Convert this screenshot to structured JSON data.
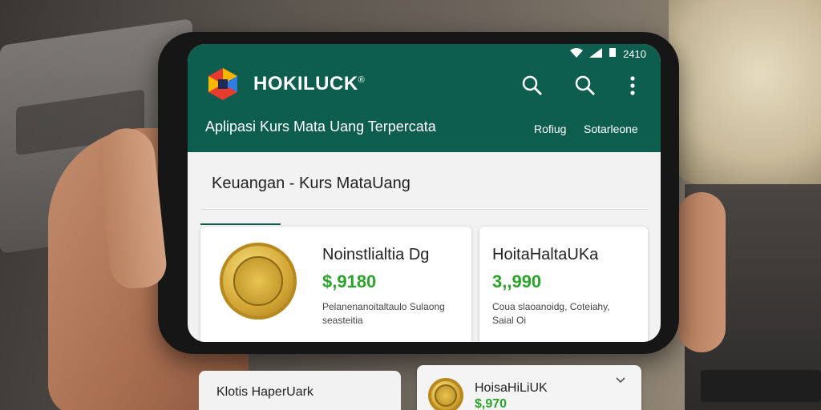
{
  "status_bar": {
    "time": "2410"
  },
  "header": {
    "brand": "HOKILUCK",
    "brand_mark": "®",
    "subtitle": "Aplipasi Kurs Mata Uang Terpercata",
    "links": [
      "Rofiug",
      "Sotarleone"
    ]
  },
  "section": {
    "title": "Keuangan - Kurs MataUang"
  },
  "cards": [
    {
      "title": "Noinstlialtia Dg",
      "value": "$,9180",
      "desc_line1": "Pelanenanoitaltaulo Sulaong",
      "desc_line2": "seasteitia"
    },
    {
      "title": "HoitaHaltaUKa",
      "value": "3,,990",
      "desc_line1": "Coua slaoanoidg, Coteiahy,",
      "desc_line2": "Saial Oi"
    }
  ],
  "bottom_left": {
    "title": "Klotis HaperUark"
  },
  "bottom_right": {
    "title": "HoisaHiLiUK",
    "value": "$,970"
  },
  "colors": {
    "appbar": "#0e5e50",
    "value_green": "#2aa52a"
  }
}
